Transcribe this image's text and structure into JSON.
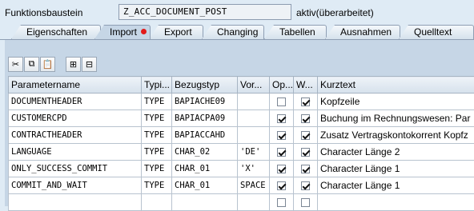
{
  "header": {
    "label": "Funktionsbaustein",
    "name": "Z_ACC_DOCUMENT_POST",
    "status": "aktiv(überarbeitet)"
  },
  "tabs": [
    {
      "label": "Eigenschaften",
      "active": false,
      "marker": false
    },
    {
      "label": "Import",
      "active": true,
      "marker": true
    },
    {
      "label": "Export",
      "active": false,
      "marker": false
    },
    {
      "label": "Changing",
      "active": false,
      "marker": false
    },
    {
      "label": "Tabellen",
      "active": false,
      "marker": false
    },
    {
      "label": "Ausnahmen",
      "active": false,
      "marker": false
    },
    {
      "label": "Quelltext",
      "active": false,
      "marker": false
    }
  ],
  "toolbar": [
    {
      "icon": "cut-icon",
      "symbol": "✂"
    },
    {
      "icon": "copy-icon",
      "symbol": "⧉"
    },
    {
      "icon": "paste-icon",
      "symbol": "📋"
    },
    {
      "icon": "insert-row-icon",
      "symbol": "⊞"
    },
    {
      "icon": "delete-row-icon",
      "symbol": "⊟"
    }
  ],
  "columns": [
    "Parametername",
    "Typi...",
    "Bezugstyp",
    "Vor...",
    "Op...",
    "W...",
    "Kurztext"
  ],
  "rows": [
    {
      "name": "DOCUMENTHEADER",
      "typing": "TYPE",
      "ref": "BAPIACHE09",
      "default": "",
      "optional": false,
      "pass_value": true,
      "text": "Kopfzeile"
    },
    {
      "name": "CUSTOMERCPD",
      "typing": "TYPE",
      "ref": "BAPIACPA09",
      "default": "",
      "optional": true,
      "pass_value": true,
      "text": "Buchung im Rechnungswesen: Par"
    },
    {
      "name": "CONTRACTHEADER",
      "typing": "TYPE",
      "ref": "BAPIACCAHD",
      "default": "",
      "optional": true,
      "pass_value": true,
      "text": "Zusatz Vertragskontokorrent Kopfz"
    },
    {
      "name": "LANGUAGE",
      "typing": "TYPE",
      "ref": "CHAR_02",
      "default": "'DE'",
      "optional": true,
      "pass_value": true,
      "text": "Character Länge 2"
    },
    {
      "name": "ONLY_SUCCESS_COMMIT",
      "typing": "TYPE",
      "ref": "CHAR_01",
      "default": "'X'",
      "optional": true,
      "pass_value": true,
      "text": "Character Länge 1"
    },
    {
      "name": "COMMIT_AND_WAIT",
      "typing": "TYPE",
      "ref": "CHAR_01",
      "default": "SPACE",
      "optional": true,
      "pass_value": true,
      "text": "Character Länge 1"
    },
    {
      "name": "",
      "typing": "",
      "ref": "",
      "default": "",
      "optional": false,
      "pass_value": false,
      "text": ""
    }
  ],
  "colors": {
    "marker": "#e21a1a",
    "panel": "#c6d6e6",
    "background": "#dfebf5"
  }
}
